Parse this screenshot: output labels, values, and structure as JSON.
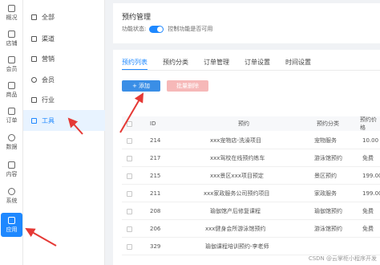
{
  "rail": {
    "items": [
      {
        "label": "概况",
        "icon": "overview-icon"
      },
      {
        "label": "店铺",
        "icon": "store-icon"
      },
      {
        "label": "会员",
        "icon": "member-icon"
      },
      {
        "label": "商品",
        "icon": "goods-icon"
      },
      {
        "label": "订单",
        "icon": "order-icon"
      },
      {
        "label": "数据",
        "icon": "data-icon"
      },
      {
        "label": "内容",
        "icon": "content-icon"
      },
      {
        "label": "系统",
        "icon": "system-icon"
      },
      {
        "label": "应用",
        "icon": "app-icon",
        "active": true
      }
    ]
  },
  "submenu": {
    "items": [
      {
        "label": "全部"
      },
      {
        "label": "渠道"
      },
      {
        "label": "营销"
      },
      {
        "label": "会员"
      },
      {
        "label": "行业"
      },
      {
        "label": "工具",
        "active": true
      }
    ]
  },
  "header": {
    "title": "预约管理",
    "toggle_label": "功能状态:",
    "toggle_desc": "控制功能是否可用"
  },
  "tabs": [
    {
      "label": "预约列表",
      "active": true
    },
    {
      "label": "预约分类"
    },
    {
      "label": "订单管理"
    },
    {
      "label": "订单设置"
    },
    {
      "label": "时间设置"
    }
  ],
  "toolbar": {
    "add_label": "+ 添加",
    "delete_label": "批量删除"
  },
  "table": {
    "headers": {
      "id": "ID",
      "name": "预约",
      "category": "预约分类",
      "price": "预约价格"
    },
    "rows": [
      {
        "id": "214",
        "name": "xxx宠物店-洗澡项目",
        "category": "宠物服务",
        "price": "10.00"
      },
      {
        "id": "217",
        "name": "xxx驾校在线预约练车",
        "category": "游泳馆预约",
        "price": "免费"
      },
      {
        "id": "215",
        "name": "xxx景区xxx项目预定",
        "category": "景区预约",
        "price": "199.00"
      },
      {
        "id": "211",
        "name": "xxx家政服务公司预约项目",
        "category": "家政服务",
        "price": "199.00"
      },
      {
        "id": "208",
        "name": "瑜伽馆产后修复课程",
        "category": "瑜伽馆预约",
        "price": "免费"
      },
      {
        "id": "206",
        "name": "xxx健身会所游泳馆预约",
        "category": "游泳馆预约",
        "price": "免费"
      },
      {
        "id": "329",
        "name": "瑜伽课程培训预约-李老师",
        "category": "",
        "price": ""
      }
    ]
  },
  "watermark": "CSDN @云掌柜小程序开发",
  "colors": {
    "accent": "#1e88ff",
    "danger_light": "#f6b8b8",
    "arrow": "#e53935"
  }
}
